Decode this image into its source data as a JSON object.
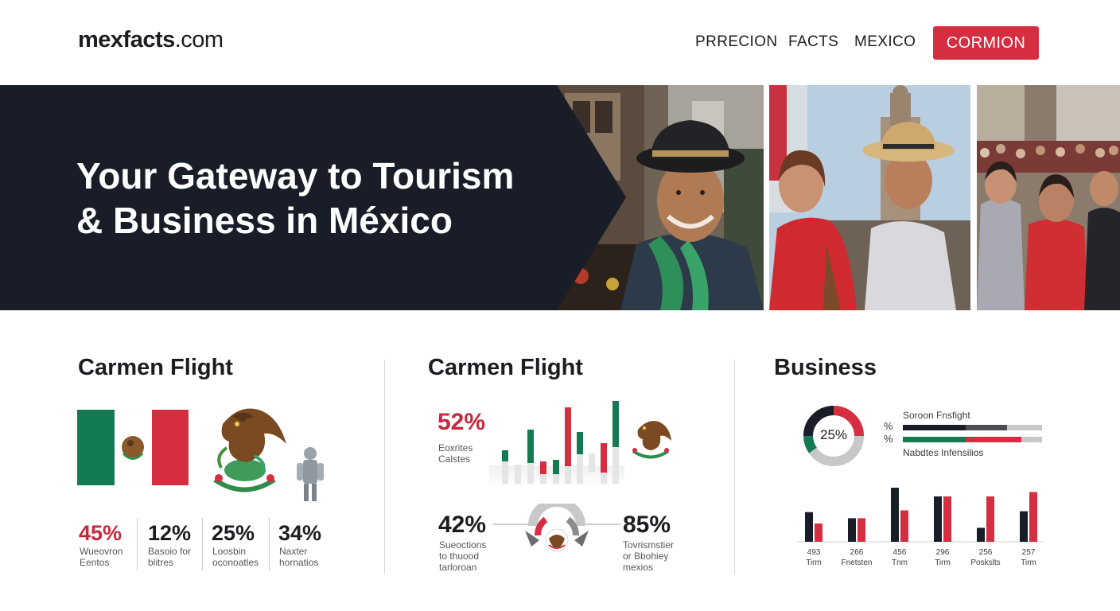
{
  "header": {
    "logo_main": "mexfacts",
    "logo_domain": ".com",
    "nav": [
      "PRRECION",
      "FACTS",
      "MEXICO"
    ],
    "cta": "CORMION"
  },
  "hero": {
    "title_line1": "Your Gateway to Tourism",
    "title_line2": "& Business in México"
  },
  "panel1": {
    "title": "Carmen Flight",
    "stats": [
      {
        "value": "45%",
        "line1": "Wueovron",
        "line2": "Eentos",
        "color": "#c6293d"
      },
      {
        "value": "12%",
        "line1": "Basoio for",
        "line2": "blitres",
        "color": "#1c1d22"
      },
      {
        "value": "25%",
        "line1": "Loosbin",
        "line2": "oconoatles",
        "color": "#1c1d22"
      },
      {
        "value": "34%",
        "line1": "Naxter",
        "line2": "hornatios",
        "color": "#1c1d22"
      }
    ]
  },
  "panel2": {
    "title": "Carmen Flight",
    "stat_top": {
      "value": "52%",
      "line1": "Eoxrites",
      "line2": "Calstes"
    },
    "stat_left": {
      "value": "42%",
      "line1": "Sueoctions",
      "line2": "to thuood",
      "line3": "tarloroan"
    },
    "stat_right": {
      "value": "85%",
      "line1": "Tovrismstier",
      "line2": "or Bbohiey",
      "line3": "mexios"
    }
  },
  "panel3": {
    "title": "Business",
    "donut_label": "25%",
    "donut_value": 25,
    "legend_pct_1": "%",
    "legend_pct_2": "%",
    "legend_top": "Soroon Fnsfight",
    "legend_bottom": "Nabdtes Infensilios",
    "bar1": [
      0.45,
      0.3,
      0.25
    ],
    "bar2": [
      0.45,
      0.4,
      0.15
    ],
    "chart_data": {
      "type": "bar",
      "categories": [
        "493 Tirm",
        "266 Fnetsten",
        "456 Tnm",
        "296 Tirm",
        "256 Poskslts",
        "257 Tirm"
      ],
      "series": [
        {
          "values": [
            34,
            27,
            62,
            52,
            16,
            35
          ]
        },
        {
          "values": [
            21,
            27,
            36,
            52,
            52,
            57
          ]
        }
      ]
    },
    "ticks": [
      {
        "num": "493",
        "label": "Tirm"
      },
      {
        "num": "266",
        "label": "Fnetsten"
      },
      {
        "num": "456",
        "label": "Tnm"
      },
      {
        "num": "296",
        "label": "Tirm"
      },
      {
        "num": "256",
        "label": "Poskslts"
      },
      {
        "num": "257",
        "label": "Tirm"
      }
    ]
  },
  "colors": {
    "dark": "#181d27",
    "red": "#d62e41",
    "green": "#006847",
    "gray": "#c8c8cb"
  }
}
